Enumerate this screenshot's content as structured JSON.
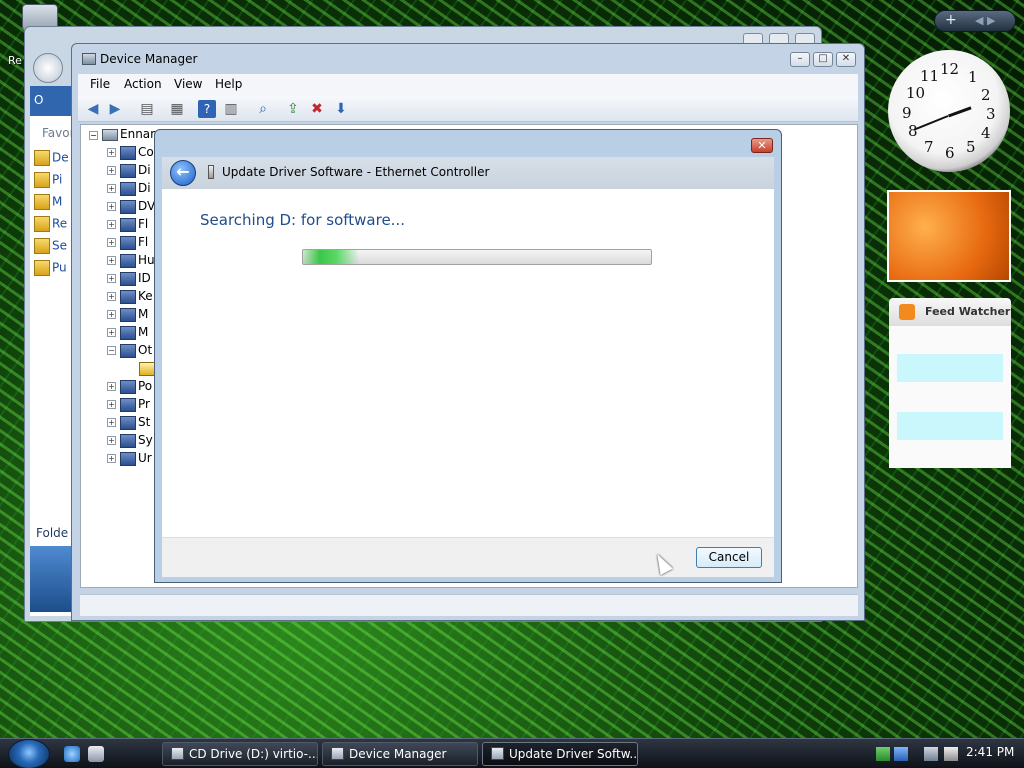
{
  "desktop": {
    "recycle_label": "Re"
  },
  "background_window": {
    "banner": "O",
    "favorites": "Favori",
    "links": [
      "De",
      "Pi",
      "M",
      "Re",
      "Se",
      "Pu"
    ],
    "folders_label": "Folde"
  },
  "device_manager": {
    "title": "Device Manager",
    "menu": [
      "File",
      "Action",
      "View",
      "Help"
    ],
    "root": "Ennar",
    "tree": [
      "Co",
      "Di",
      "Di",
      "DV",
      "Fl",
      "Fl",
      "Hu",
      "ID",
      "Ke",
      "M",
      "M",
      "Ot",
      "Po",
      "Pr",
      "St",
      "Sy",
      "Ur"
    ]
  },
  "dialog": {
    "title": "Update Driver Software - Ethernet Controller",
    "searching": "Searching D: for software...",
    "progress": 0.16,
    "cancel_label": "Cancel",
    "close_glyph": "✕"
  },
  "sidebar": {
    "plus": "+",
    "feed_title": "Feed Watcher",
    "clock_numbers": [
      "12",
      "1",
      "2",
      "3",
      "4",
      "5",
      "6",
      "7",
      "8",
      "9",
      "10",
      "11"
    ]
  },
  "taskbar": {
    "tasks": [
      {
        "label": "CD Drive (D:) virtio-...",
        "active": false
      },
      {
        "label": "Device Manager",
        "active": false
      },
      {
        "label": "Update Driver Softw...",
        "active": true
      }
    ],
    "time": "2:41 PM"
  },
  "colors": {
    "accent": "#1f4e8a",
    "progress_green": "#3cc64a"
  }
}
